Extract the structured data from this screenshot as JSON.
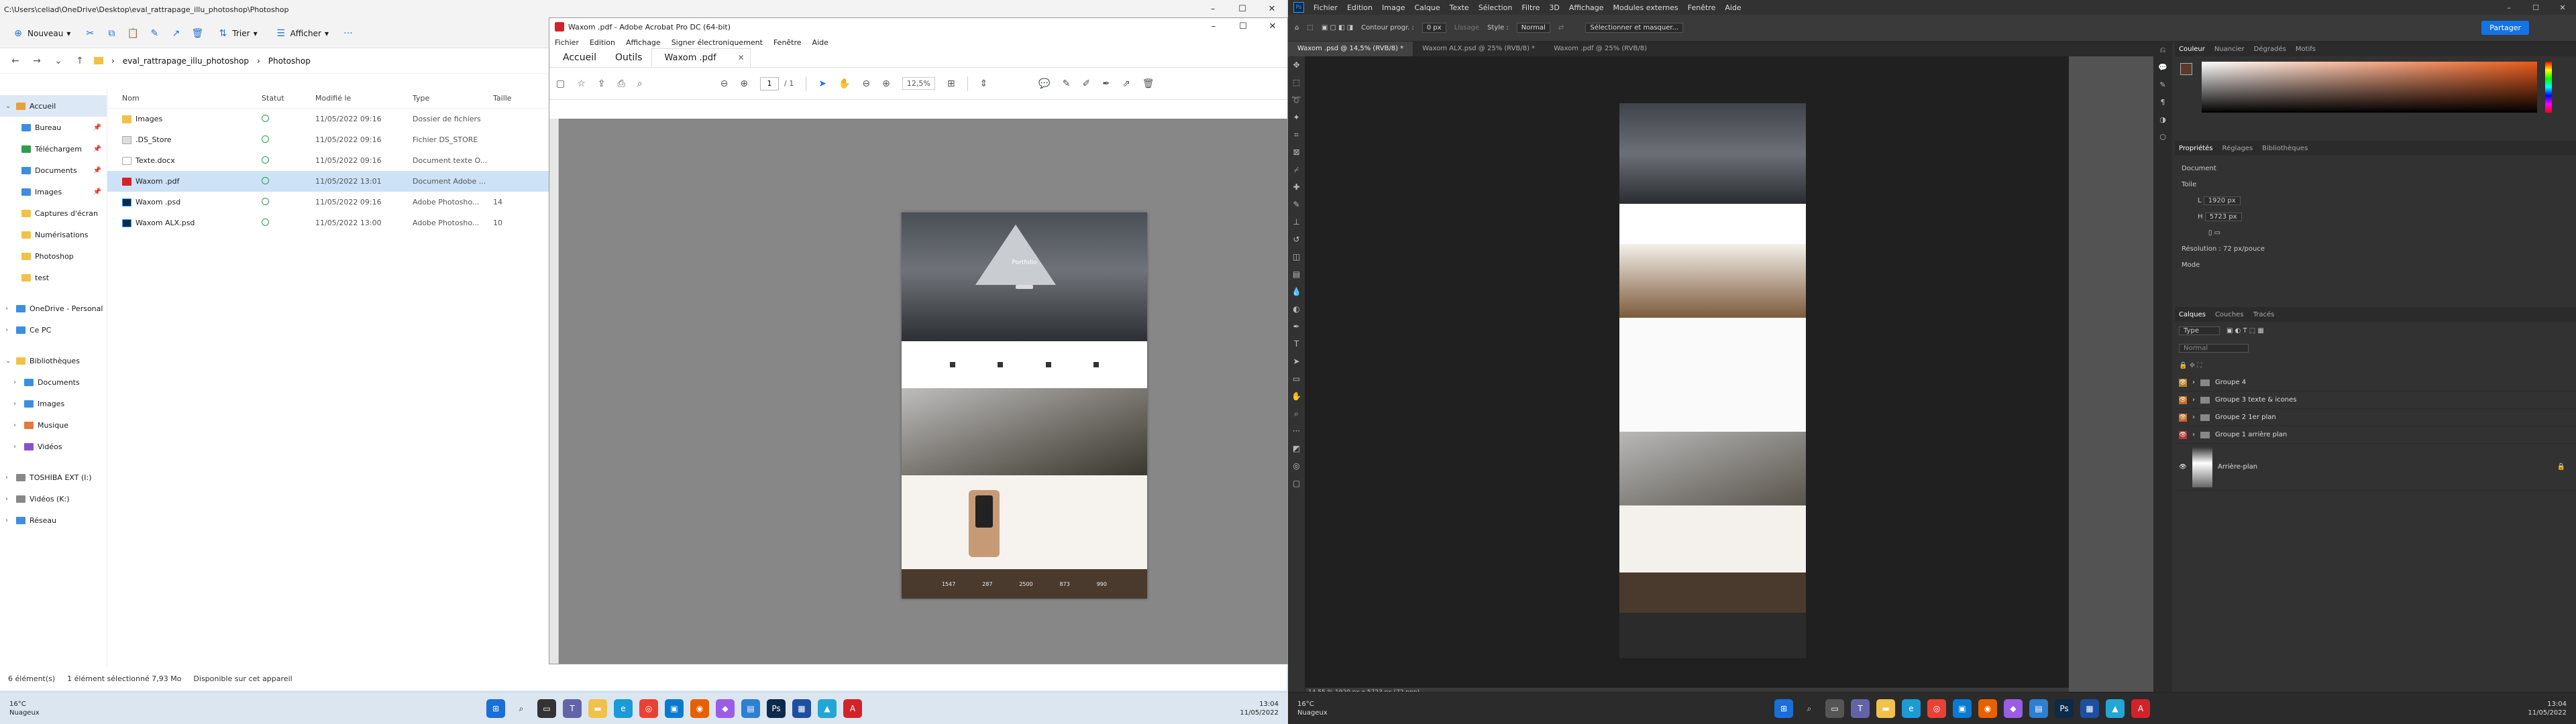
{
  "explorer": {
    "title_path": "C:\\Users\\celiad\\OneDrive\\Desktop\\eval_rattrapage_illu_photoshop\\Photoshop",
    "cmd": {
      "new": "Nouveau",
      "sort": "Trier",
      "view": "Afficher"
    },
    "breadcrumb": [
      "eval_rattrapage_illu_photoshop",
      "Photoshop"
    ],
    "sidebar": [
      {
        "label": "Accueil",
        "selected": true
      },
      {
        "label": "Bureau"
      },
      {
        "label": "Téléchargem"
      },
      {
        "label": "Documents"
      },
      {
        "label": "Images"
      },
      {
        "label": "Captures d'écran"
      },
      {
        "label": "Numérisations"
      },
      {
        "label": "Photoshop"
      },
      {
        "label": "test"
      },
      {
        "label": "OneDrive - Personal"
      },
      {
        "label": "Ce PC"
      },
      {
        "label": "Bibliothèques"
      },
      {
        "label": "Documents"
      },
      {
        "label": "Images"
      },
      {
        "label": "Musique"
      },
      {
        "label": "Vidéos"
      },
      {
        "label": "TOSHIBA EXT (I:)"
      },
      {
        "label": "Vidéos (K:)"
      },
      {
        "label": "Réseau"
      }
    ],
    "columns": {
      "name": "Nom",
      "status": "Statut",
      "date": "Modifié le",
      "type": "Type",
      "size": "Taille"
    },
    "files": [
      {
        "name": "Images",
        "date": "11/05/2022 09:16",
        "type": "Dossier de fichiers",
        "size": ""
      },
      {
        "name": ".DS_Store",
        "date": "11/05/2022 09:16",
        "type": "Fichier DS_STORE",
        "size": ""
      },
      {
        "name": "Texte.docx",
        "date": "11/05/2022 09:16",
        "type": "Document texte O...",
        "size": ""
      },
      {
        "name": "Waxom .pdf",
        "date": "11/05/2022 13:01",
        "type": "Document Adobe ...",
        "size": ""
      },
      {
        "name": "Waxom .psd",
        "date": "11/05/2022 09:16",
        "type": "Adobe Photosho...",
        "size": "14"
      },
      {
        "name": "Waxom ALX.psd",
        "date": "11/05/2022 13:00",
        "type": "Adobe Photosho...",
        "size": "10"
      }
    ],
    "status": {
      "count": "6 élément(s)",
      "selected": "1 élément sélectionné  7,93 Mo",
      "avail": "Disponible sur cet appareil"
    }
  },
  "acrobat": {
    "title": "Waxom .pdf - Adobe Acrobat Pro DC (64-bit)",
    "menu": [
      "Fichier",
      "Edition",
      "Affichage",
      "Signer électroniquement",
      "Fenêtre",
      "Aide"
    ],
    "tabs": {
      "home": "Accueil",
      "tools": "Outils",
      "doc": "Waxom .pdf"
    },
    "page_current": "1",
    "page_total": "/ 1",
    "zoom": "12,5%",
    "page_texts": {
      "hero_title": "Portfolio",
      "stats": [
        "1547",
        "287",
        "2500",
        "873",
        "990"
      ]
    }
  },
  "photoshop": {
    "menu": [
      "Fichier",
      "Edition",
      "Image",
      "Calque",
      "Texte",
      "Sélection",
      "Filtre",
      "3D",
      "Affichage",
      "Modules externes",
      "Fenêtre",
      "Aide"
    ],
    "options": {
      "contour": "Contour progr. :",
      "contour_val": "0 px",
      "lissage": "Lissage",
      "style": "Style :",
      "style_val": "Normal",
      "refine": "Sélectionner et masquer...",
      "share": "Partager"
    },
    "tabs": [
      "Waxom .psd @ 14,5% (RVB/8) *",
      "Waxom ALX.psd @ 25% (RVB/8) *",
      "Waxom .pdf @ 25% (RVB/8)"
    ],
    "status": "14,55 %    1920 px x 5723 px (72 ppp)",
    "color_tabs": [
      "Couleur",
      "Nuancier",
      "Dégradés",
      "Motifs"
    ],
    "props_tabs": [
      "Propriétés",
      "Réglages",
      "Bibliothèques"
    ],
    "props": {
      "doc": "Document",
      "section": "Toile",
      "w": "1920 px",
      "h": "5723 px",
      "res": "Résolution : 72 px/pouce",
      "mode": "Mode"
    },
    "layers_tabs": [
      "Calques",
      "Couches",
      "Tracés"
    ],
    "layers_search": "Type",
    "layers_blend": "Normal",
    "layers": [
      {
        "name": "Groupe 4",
        "color": "y"
      },
      {
        "name": "Groupe 3 texte & icones",
        "color": "o"
      },
      {
        "name": "Groupe 2 1er plan",
        "color": "o"
      },
      {
        "name": "Groupe 1 arrière plan",
        "color": "r"
      }
    ],
    "bg_layer": "Arrière-plan"
  },
  "taskbar": {
    "temp": "16°C",
    "cond": "Nuageux",
    "time": "13:04",
    "date": "11/05/2022"
  }
}
